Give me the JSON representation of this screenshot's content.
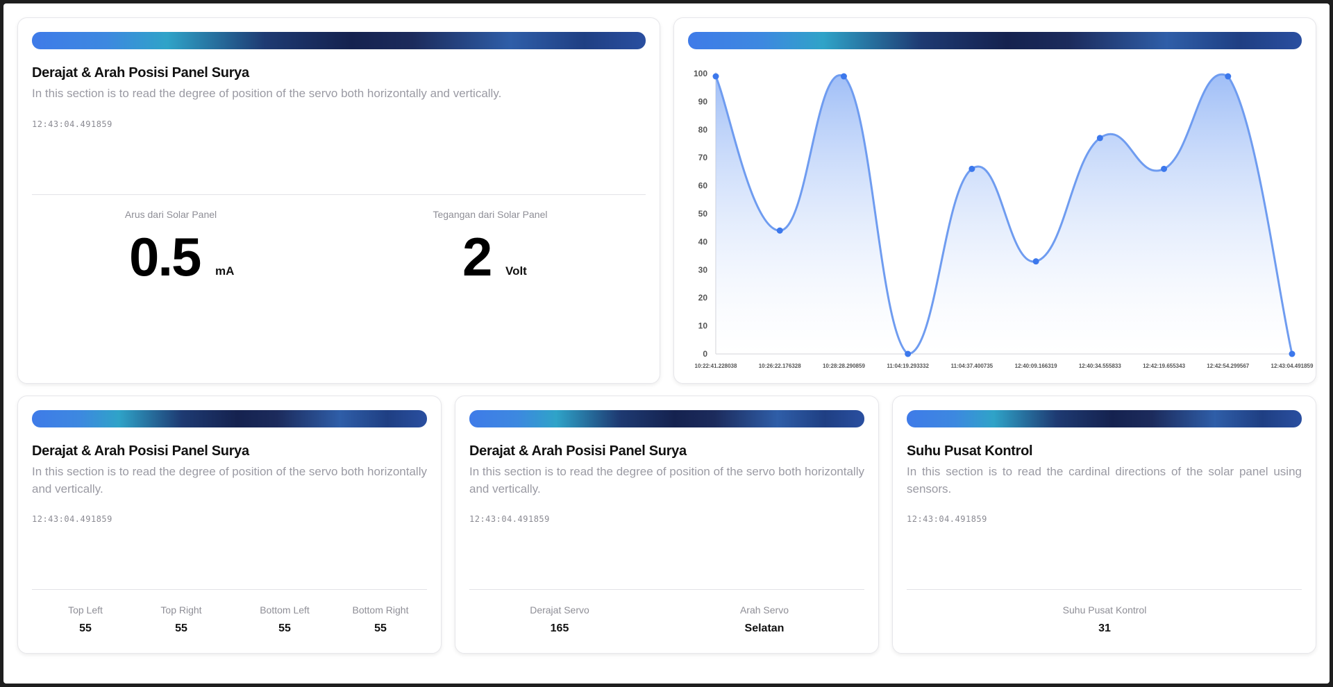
{
  "colors": {
    "line": "#6f9cf0",
    "point": "#3c78ec",
    "fill_top": "#8fb3f5",
    "fill_bottom": "#ffffff"
  },
  "top_card": {
    "title": "Derajat & Arah Posisi Panel Surya",
    "description": "In this section is to read the degree of position of the servo both horizontally and vertically.",
    "timestamp": "12:43:04.491859",
    "current": {
      "label": "Arus dari Solar Panel",
      "value": "0.5",
      "unit": "mA"
    },
    "voltage": {
      "label": "Tegangan dari Solar Panel",
      "value": "2",
      "unit": "Volt"
    }
  },
  "chart_data": {
    "type": "area",
    "title": "",
    "xlabel": "",
    "ylabel": "",
    "x": [
      "10:22:41.228038",
      "10:26:22.176328",
      "10:28:28.290859",
      "11:04:19.293332",
      "11:04:37.400735",
      "12:40:09.166319",
      "12:40:34.555833",
      "12:42:19.655343",
      "12:42:54.299567",
      "12:43:04.491859"
    ],
    "series": [
      {
        "values": [
          99,
          44,
          99,
          0,
          66,
          33,
          77,
          66,
          99,
          0
        ]
      }
    ],
    "ylim": [
      0,
      100
    ],
    "yticks": [
      "0",
      "10",
      "20",
      "30",
      "40",
      "50",
      "60",
      "70",
      "80",
      "90",
      "100"
    ],
    "grid": false,
    "smooth": true
  },
  "ldr_card": {
    "title": "Derajat & Arah Posisi Panel Surya",
    "description": "In this section is to read the degree of position of the servo both horizontally and vertically.",
    "timestamp": "12:43:04.491859",
    "stats": [
      {
        "label": "Top Left",
        "value": "55"
      },
      {
        "label": "Top Right",
        "value": "55"
      },
      {
        "label": "Bottom Left",
        "value": "55"
      },
      {
        "label": "Bottom Right",
        "value": "55"
      }
    ]
  },
  "servo_card": {
    "title": "Derajat & Arah Posisi Panel Surya",
    "description": "In this section is to read the degree of position of the servo both horizontally and vertically.",
    "timestamp": "12:43:04.491859",
    "stats": [
      {
        "label": "Derajat Servo",
        "value": "165"
      },
      {
        "label": "Arah Servo",
        "value": "Selatan"
      }
    ]
  },
  "temp_card": {
    "title": "Suhu Pusat Kontrol",
    "description": "In this section is to read the cardinal directions of the solar panel using sensors.",
    "timestamp": "12:43:04.491859",
    "stats": [
      {
        "label": "Suhu Pusat Kontrol",
        "value": "31"
      }
    ]
  }
}
